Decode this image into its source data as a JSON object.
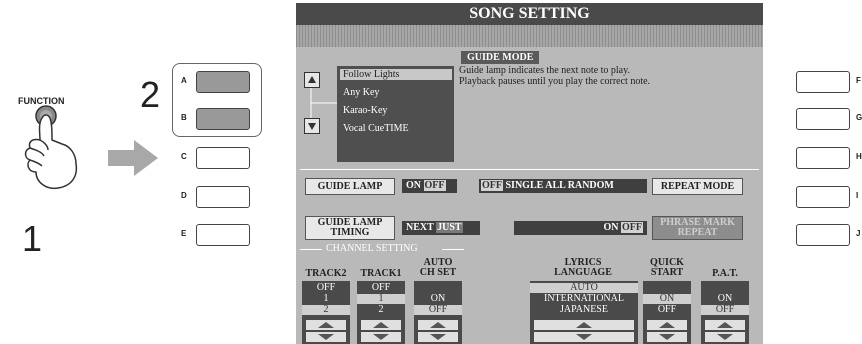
{
  "steps": {
    "step1": "1",
    "step2": "2"
  },
  "panel": {
    "function_label": "FUNCTION",
    "left_buttons": [
      {
        "letter": "A",
        "pressed": true
      },
      {
        "letter": "B",
        "pressed": true
      },
      {
        "letter": "C",
        "pressed": false
      },
      {
        "letter": "D",
        "pressed": false
      },
      {
        "letter": "E",
        "pressed": false
      }
    ],
    "right_buttons": [
      {
        "letter": "F"
      },
      {
        "letter": "G"
      },
      {
        "letter": "H"
      },
      {
        "letter": "I"
      },
      {
        "letter": "J"
      }
    ]
  },
  "screen": {
    "title": "SONG SETTING",
    "guide_mode": {
      "tab_label": "GUIDE MODE",
      "description": "Guide lamp indicates the next note to play.\nPlayback pauses until you play the correct note.",
      "options": [
        "Follow Lights",
        "Any Key",
        "Karao-Key",
        "Vocal CueTIME"
      ],
      "selected": "Follow Lights"
    },
    "guide_lamp": {
      "label": "GUIDE LAMP",
      "on": "ON",
      "off": "OFF"
    },
    "random_row": {
      "off": "OFF",
      "single": "SINGLE",
      "all": "ALL",
      "random": "RANDOM"
    },
    "repeat_mode": "REPEAT MODE",
    "guide_lamp_timing": {
      "label_line1": "GUIDE LAMP",
      "label_line2": "TIMING",
      "next": "NEXT",
      "just": "JUST"
    },
    "phrase_row": {
      "on": "ON",
      "off": "OFF"
    },
    "phrase_mark_repeat": {
      "line1": "PHRASE MARK",
      "line2": "REPEAT"
    },
    "channel_setting": "CHANNEL SETTING",
    "columns": {
      "track2": {
        "head": "TRACK2",
        "values": [
          "OFF",
          "1",
          "2"
        ]
      },
      "track1": {
        "head": "TRACK1",
        "values": [
          "OFF",
          "1",
          "2"
        ]
      },
      "auto_ch_set": {
        "head1": "AUTO",
        "head2": "CH SET",
        "values": [
          "ON",
          "OFF"
        ]
      },
      "lyrics_language": {
        "head1": "LYRICS",
        "head2": "LANGUAGE",
        "values": [
          "AUTO",
          "INTERNATIONAL",
          "JAPANESE"
        ]
      },
      "quick_start": {
        "head1": "QUICK",
        "head2": "START",
        "values": [
          "ON",
          "OFF"
        ]
      },
      "pat": {
        "head": "P.A.T.",
        "values": [
          "ON",
          "OFF"
        ]
      }
    }
  }
}
